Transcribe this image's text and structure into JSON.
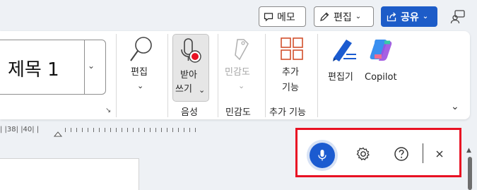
{
  "top_bar": {
    "memo_label": "메모",
    "edit_label": "편집",
    "share_label": "공유"
  },
  "ribbon": {
    "style_name": "제목 1",
    "editing_label": "편집",
    "dictate_label_line1": "받아",
    "dictate_label_line2": "쓰기",
    "sensitivity_label": "민감도",
    "addins_label_line1": "추가",
    "addins_label_line2": "기능",
    "editor_label": "편집기",
    "copilot_label": "Copilot",
    "group_voice": "음성",
    "group_sensitivity": "민감도",
    "group_addins": "추가 기능"
  },
  "ruler": {
    "text": "| |38| |40| |"
  },
  "dictation_toolbar": {
    "mic_icon": "microphone-icon",
    "settings_icon": "gear-icon",
    "help_icon": "question-circle-icon",
    "close_icon": "close-icon",
    "highlight_color": "#e81123",
    "accent_color": "#1b5bd0"
  },
  "colors": {
    "share_button": "#1d5cc8",
    "ribbon_bg": "#ffffff",
    "canvas_bg": "#eef1f5"
  }
}
